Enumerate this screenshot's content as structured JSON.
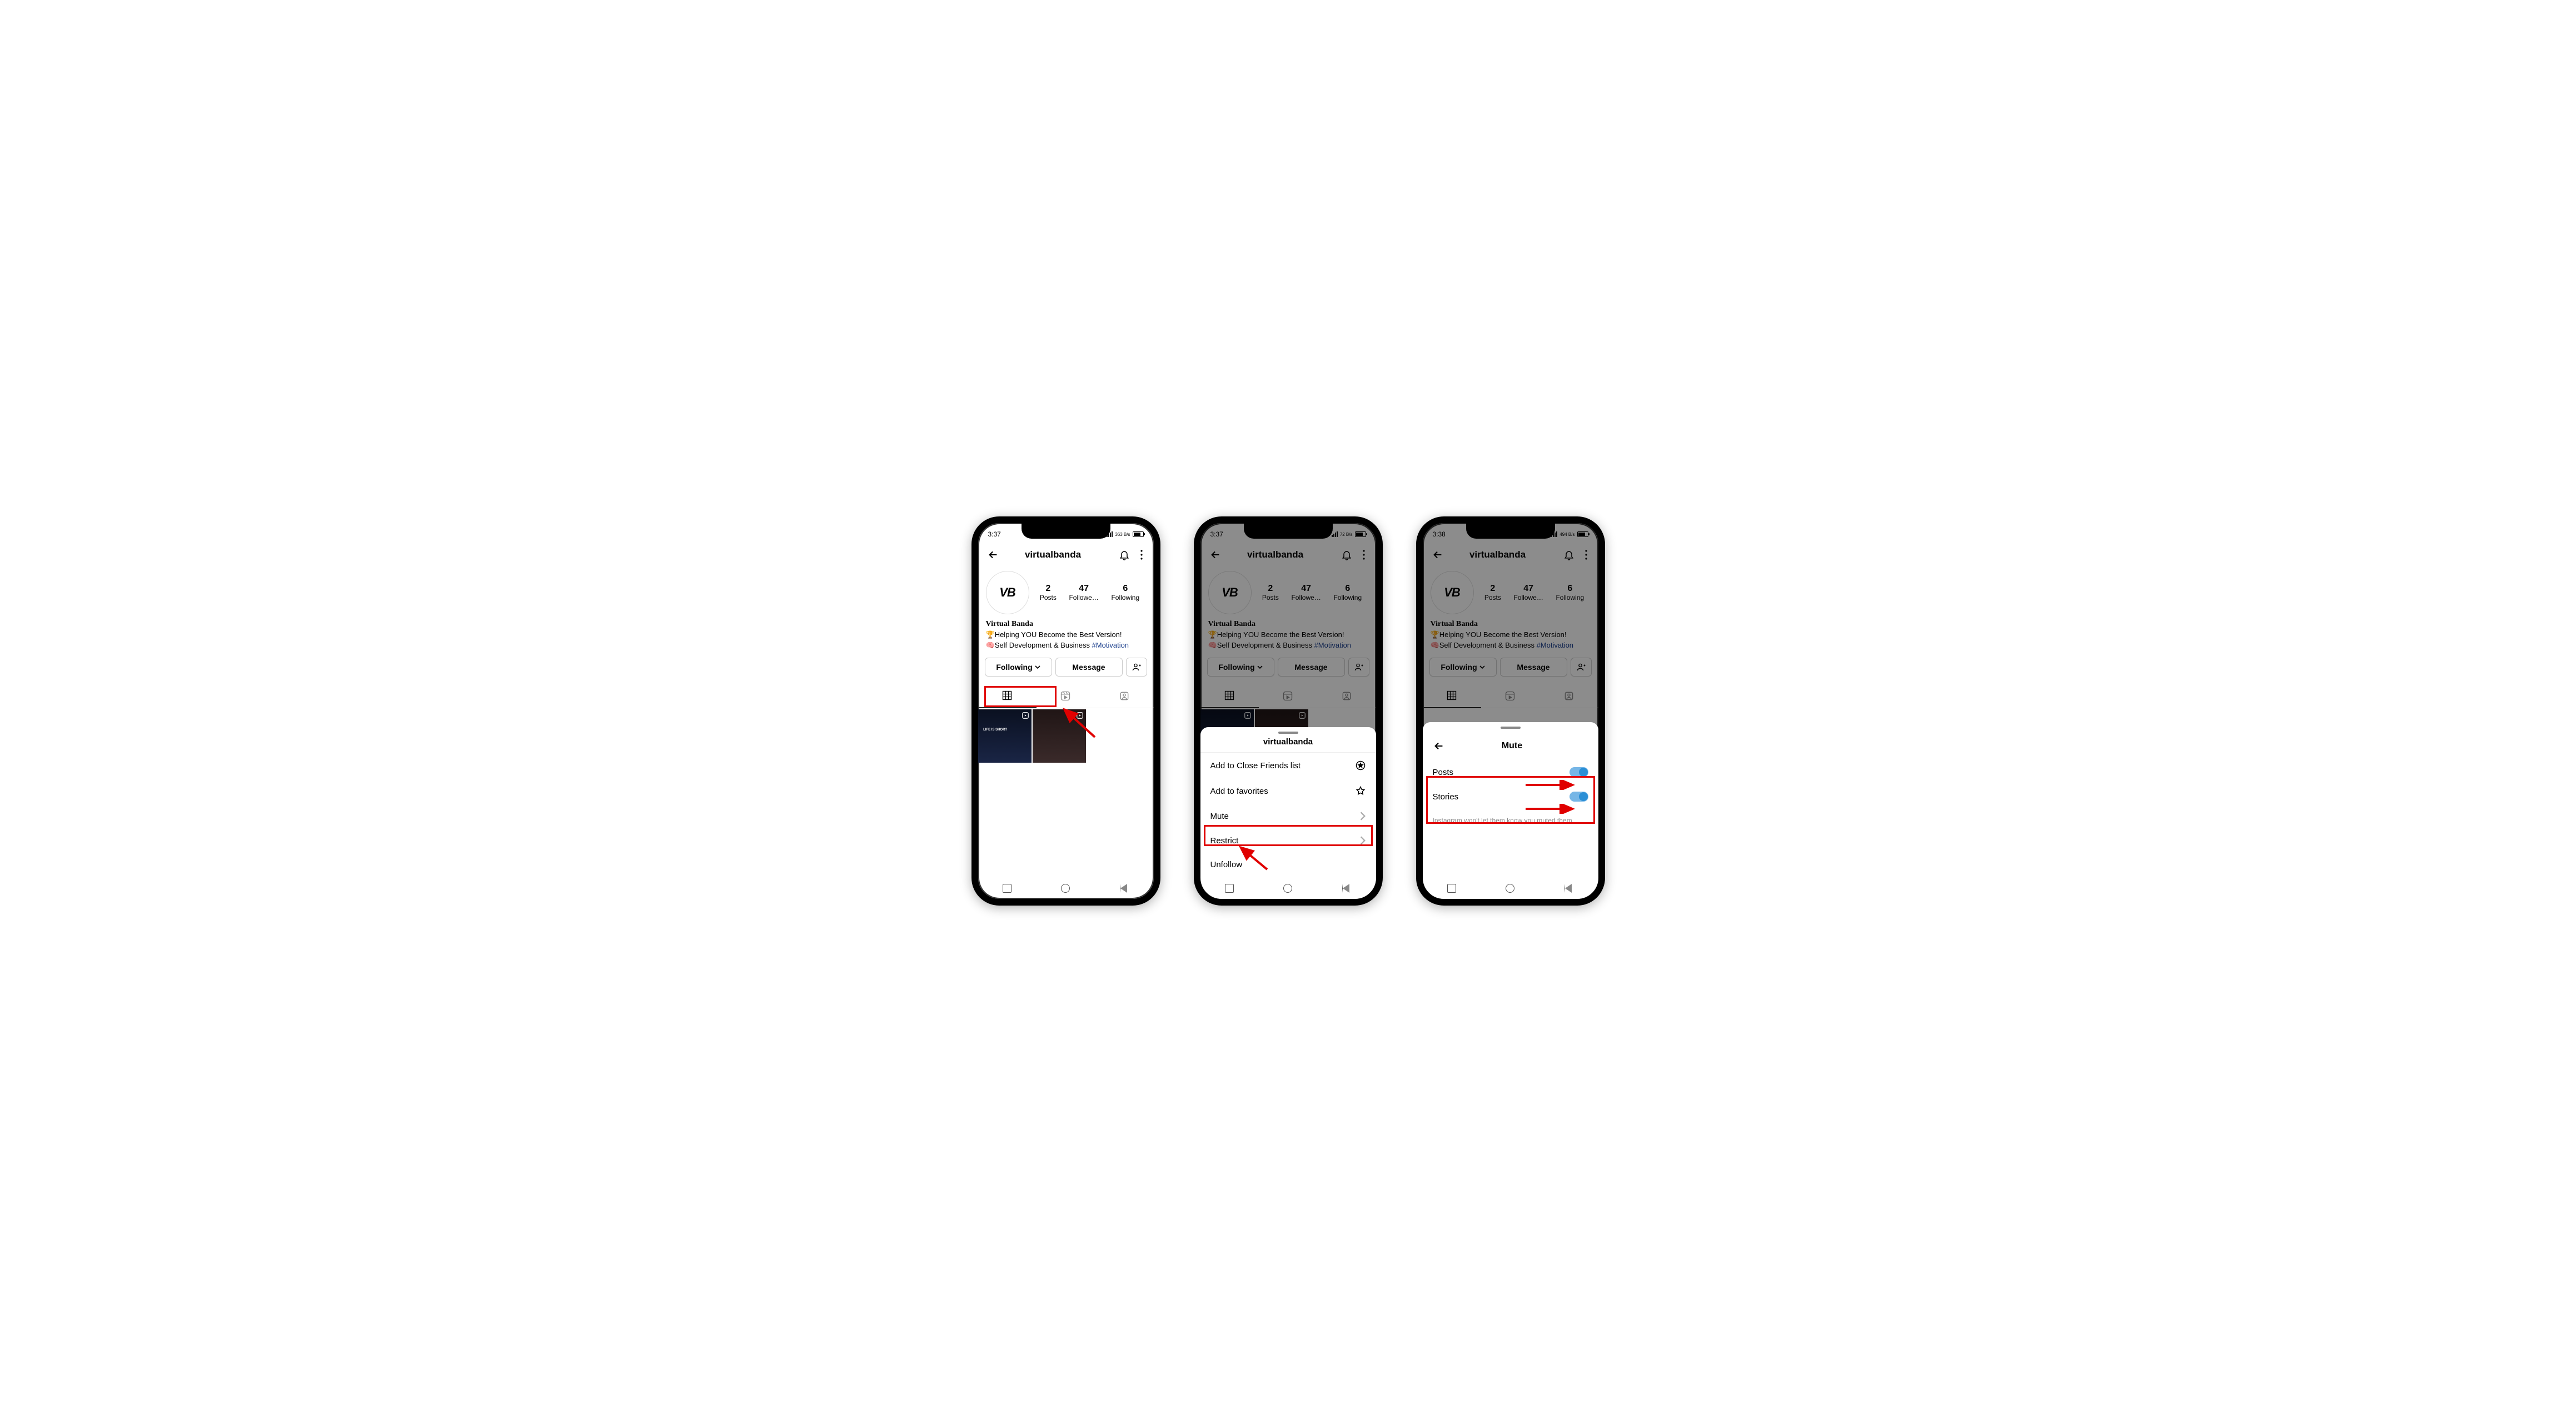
{
  "statusbar": {
    "time1": "3:37",
    "time2": "3:37",
    "time3": "3:38",
    "net1": "363 B/s",
    "net2": "72 B/s",
    "net3": "494 B/s"
  },
  "header": {
    "username": "virtualbanda"
  },
  "stats": {
    "posts_n": "2",
    "posts_l": "Posts",
    "followers_n": "47",
    "followers_l": "Followe…",
    "following_n": "6",
    "following_l": "Following"
  },
  "bio": {
    "name": "Virtual Banda",
    "line1_emoji": "🏆",
    "line1": "Helping YOU Become the Best Version!",
    "line2_emoji": "🧠",
    "line2": "Self Development & Business ",
    "hashtag": "#Motivation",
    "post_caption": "LIFE IS SHORT"
  },
  "buttons": {
    "following": "Following",
    "message": "Message"
  },
  "sheet1": {
    "title": "virtualbanda",
    "row1": "Add to Close Friends list",
    "row2": "Add to favorites",
    "row3": "Mute",
    "row4": "Restrict",
    "row5": "Unfollow"
  },
  "sheet2": {
    "title": "Mute",
    "row1": "Posts",
    "row2": "Stories",
    "hint": "Instagram won't let them know you muted them."
  }
}
